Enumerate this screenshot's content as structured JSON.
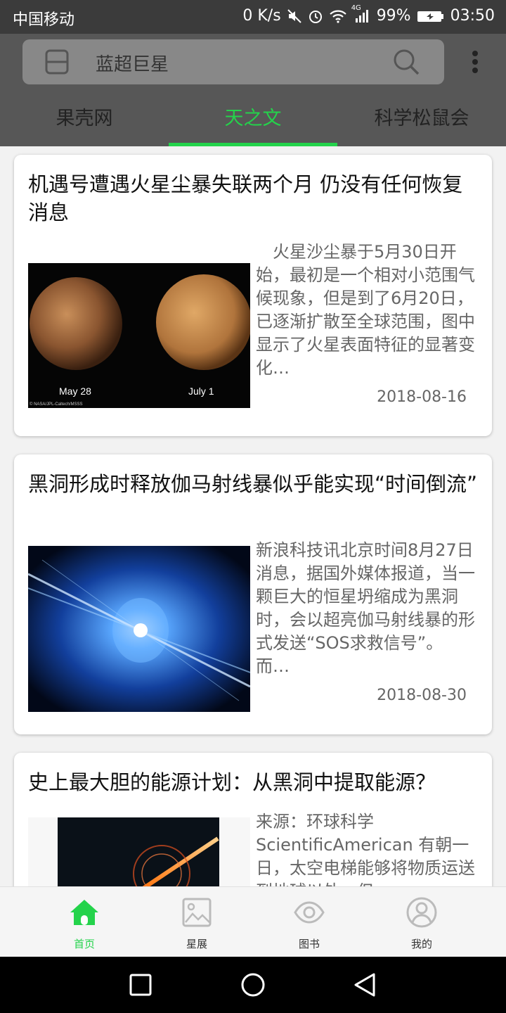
{
  "status_bar": {
    "carrier": "中国移动",
    "net_speed": "0 K/s",
    "signal_type": "4G",
    "battery": "99%",
    "time": "03:50"
  },
  "search": {
    "value": "蓝超巨星"
  },
  "tabs": [
    {
      "label": "果壳网",
      "active": false
    },
    {
      "label": "天之文",
      "active": true
    },
    {
      "label": "科学松鼠会",
      "active": false
    }
  ],
  "articles": [
    {
      "title": "机遇号遭遇火星尘暴失联两个月 仍没有任何恢复消息",
      "summary": "　火星沙尘暴于5月30日开始，最初是一个相对小范围气候现象，但是到了6月20日，已逐渐扩散至全球范围，图中显示了火星表面特征的显著变化…",
      "date": "2018-08-16",
      "image": {
        "left_caption": "May 28",
        "right_caption": "July 1",
        "credit": "© NASA/JPL-Caltech/MSSS"
      }
    },
    {
      "title": "黑洞形成时释放伽马射线暴似乎能实现“时间倒流”",
      "summary": "新浪科技讯北京时间8月27日消息，据国外媒体报道，当一颗巨大的恒星坍缩成为黑洞时，会以超亮伽马射线暴的形式发送“SOS求救信号”。而…",
      "date": "2018-08-30"
    },
    {
      "title": "史上最大胆的能源计划：从黑洞中提取能源？",
      "summary": "来源：环球科学ScientificAmerican 有朝一日，太空电梯能够将物质运送到地球以外，但…",
      "date": ""
    }
  ],
  "bottom_nav": [
    {
      "label": "首页",
      "icon": "home-icon",
      "active": true
    },
    {
      "label": "星展",
      "icon": "image-icon",
      "active": false
    },
    {
      "label": "图书",
      "icon": "eye-icon",
      "active": false
    },
    {
      "label": "我的",
      "icon": "user-icon",
      "active": false
    }
  ],
  "colors": {
    "accent": "#24d34b",
    "header": "#575757",
    "status_bar": "#3b3b3b"
  }
}
